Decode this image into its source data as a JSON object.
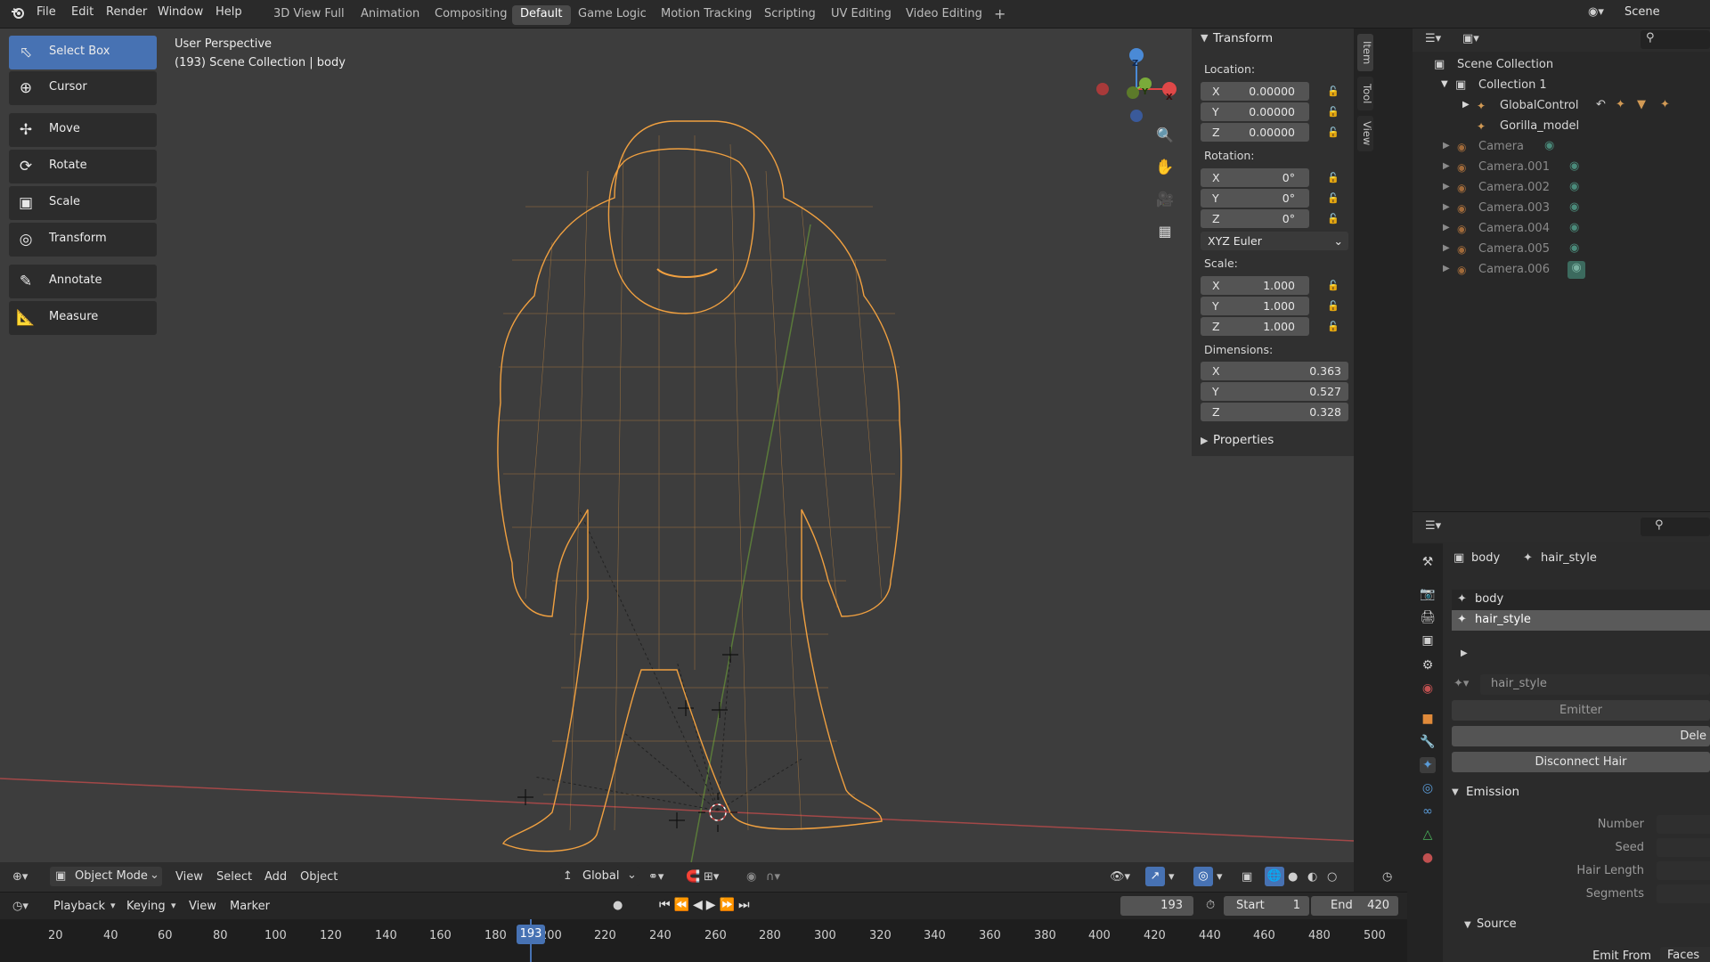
{
  "topbar": {
    "menus": [
      "File",
      "Edit",
      "Render",
      "Window",
      "Help"
    ],
    "workspaces": [
      "3D View Full",
      "Animation",
      "Compositing",
      "Default",
      "Game Logic",
      "Motion Tracking",
      "Scripting",
      "UV Editing",
      "Video Editing"
    ],
    "active_workspace": "Default",
    "add_tab": "+",
    "scene_label": "Scene"
  },
  "viewport": {
    "perspective": "User Perspective",
    "info": "(193) Scene Collection | body",
    "gizmo": {
      "z": "Z",
      "x": "X",
      "y": "Y"
    }
  },
  "toolbar": {
    "tools": [
      {
        "label": "Select Box",
        "icon": "select-box-icon",
        "active": true
      },
      {
        "label": "Cursor",
        "icon": "cursor-icon",
        "active": false
      },
      {
        "label": "Move",
        "icon": "move-icon",
        "active": false
      },
      {
        "label": "Rotate",
        "icon": "rotate-icon",
        "active": false
      },
      {
        "label": "Scale",
        "icon": "scale-icon",
        "active": false
      },
      {
        "label": "Transform",
        "icon": "transform-icon",
        "active": false
      },
      {
        "label": "Annotate",
        "icon": "annotate-icon",
        "active": false
      },
      {
        "label": "Measure",
        "icon": "measure-icon",
        "active": false
      }
    ]
  },
  "npanel": {
    "title": "Transform",
    "location_label": "Location:",
    "location": [
      {
        "axis": "X",
        "value": "0.00000"
      },
      {
        "axis": "Y",
        "value": "0.00000"
      },
      {
        "axis": "Z",
        "value": "0.00000"
      }
    ],
    "rotation_label": "Rotation:",
    "rotation": [
      {
        "axis": "X",
        "value": "0°"
      },
      {
        "axis": "Y",
        "value": "0°"
      },
      {
        "axis": "Z",
        "value": "0°"
      }
    ],
    "rotation_mode": "XYZ Euler",
    "scale_label": "Scale:",
    "scale": [
      {
        "axis": "X",
        "value": "1.000"
      },
      {
        "axis": "Y",
        "value": "1.000"
      },
      {
        "axis": "Z",
        "value": "1.000"
      }
    ],
    "dimensions_label": "Dimensions:",
    "dimensions": [
      {
        "axis": "X",
        "value": "0.363"
      },
      {
        "axis": "Y",
        "value": "0.527"
      },
      {
        "axis": "Z",
        "value": "0.328"
      }
    ],
    "properties_label": "Properties",
    "side_tabs": [
      "Item",
      "Tool",
      "View"
    ]
  },
  "outliner": {
    "rows": [
      {
        "label": "Scene Collection",
        "dim": false
      },
      {
        "label": "Collection 1",
        "dim": false
      },
      {
        "label": "GlobalControl",
        "dim": false
      },
      {
        "label": "Gorilla_model",
        "dim": false
      },
      {
        "label": "Camera",
        "dim": true
      },
      {
        "label": "Camera.001",
        "dim": true
      },
      {
        "label": "Camera.002",
        "dim": true
      },
      {
        "label": "Camera.003",
        "dim": true
      },
      {
        "label": "Camera.004",
        "dim": true
      },
      {
        "label": "Camera.005",
        "dim": true
      },
      {
        "label": "Camera.006",
        "dim": true
      }
    ]
  },
  "properties": {
    "breadcrumb_object": "body",
    "breadcrumb_psys": "hair_style",
    "list_items": [
      "body",
      "hair_style"
    ],
    "selected_item": "hair_style",
    "psys_name": "hair_style",
    "emitter_button": "Emitter",
    "delete_button": "Dele",
    "disconnect_button": "Disconnect Hair",
    "emission_label": "Emission",
    "emission_fields": [
      "Number",
      "Seed",
      "Hair Length",
      "Segments"
    ],
    "source_label": "Source",
    "emit_from_label": "Emit From",
    "emit_from_value": "Faces"
  },
  "vpheader": {
    "mode": "Object Mode",
    "menus": [
      "View",
      "Select",
      "Add",
      "Object"
    ],
    "orientation": "Global"
  },
  "timeline": {
    "menus": [
      "Playback",
      "Keying",
      "View",
      "Marker"
    ],
    "current_frame": "193",
    "start_label": "Start",
    "start_value": "1",
    "end_label": "End",
    "end_value": "420",
    "ticks": [
      "20",
      "40",
      "60",
      "80",
      "100",
      "120",
      "140",
      "160",
      "180",
      "200",
      "220",
      "240",
      "260",
      "280",
      "300",
      "320",
      "340",
      "360",
      "380",
      "400",
      "420",
      "440",
      "460",
      "480",
      "500"
    ],
    "playhead_label": "193"
  },
  "colors": {
    "accent": "#4772b3",
    "wireframe": "#f0a040",
    "background": "#3d3d3d"
  }
}
